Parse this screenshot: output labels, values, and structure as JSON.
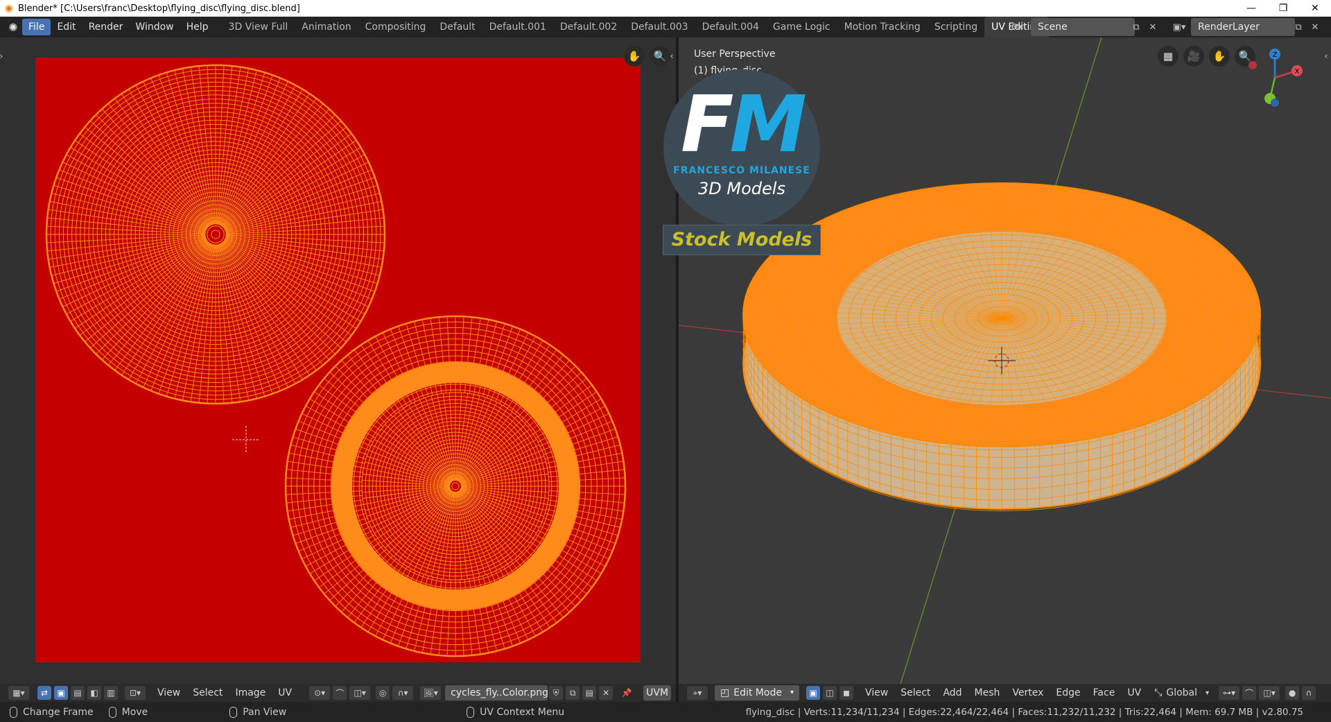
{
  "window": {
    "title": "Blender* [C:\\Users\\franc\\Desktop\\flying_disc\\flying_disc.blend]",
    "controls": [
      "—",
      "❐",
      "✕"
    ]
  },
  "menu": {
    "items": [
      "File",
      "Edit",
      "Render",
      "Window",
      "Help"
    ]
  },
  "workspaces": {
    "tabs": [
      "3D View Full",
      "Animation",
      "Compositing",
      "Default",
      "Default.001",
      "Default.002",
      "Default.003",
      "Default.004",
      "Game Logic",
      "Motion Tracking",
      "Scripting",
      "UV Editing"
    ],
    "active": "UV Editing"
  },
  "scene": {
    "name": "Scene",
    "render_layer": "RenderLayer"
  },
  "uv_editor": {
    "background_color": "#c50000",
    "image_name": "cycles_fly..Color.png",
    "menus": [
      "View",
      "Select",
      "Image",
      "UV"
    ],
    "uvmap_label": "UVM"
  },
  "viewport": {
    "perspective": "User Perspective",
    "object_label": "(1) flying_disc",
    "mode": "Edit Mode",
    "menus": [
      "View",
      "Select",
      "Add",
      "Mesh",
      "Vertex",
      "Edge",
      "Face",
      "UV"
    ],
    "transform": "Global",
    "gizmo": {
      "z": "Z",
      "x": "X"
    }
  },
  "logo": {
    "letters_f": "F",
    "letters_m": "M",
    "name": "FRANCESCO MILANESE",
    "models": "3D Models",
    "stock": "Stock Models"
  },
  "status": {
    "change_frame": "Change Frame",
    "move": "Move",
    "pan_view": "Pan View",
    "uv_context": "UV Context Menu",
    "stats": "flying_disc | Verts:11,234/11,234 | Edges:22,464/22,464 | Faces:11,232/11,232 | Tris:22,464 | Mem: 69.7 MB | v2.80.75"
  },
  "colors": {
    "accent": "#4772b3",
    "uv_orange": "#ff8c1a",
    "mesh_orange": "#ff8a00"
  }
}
